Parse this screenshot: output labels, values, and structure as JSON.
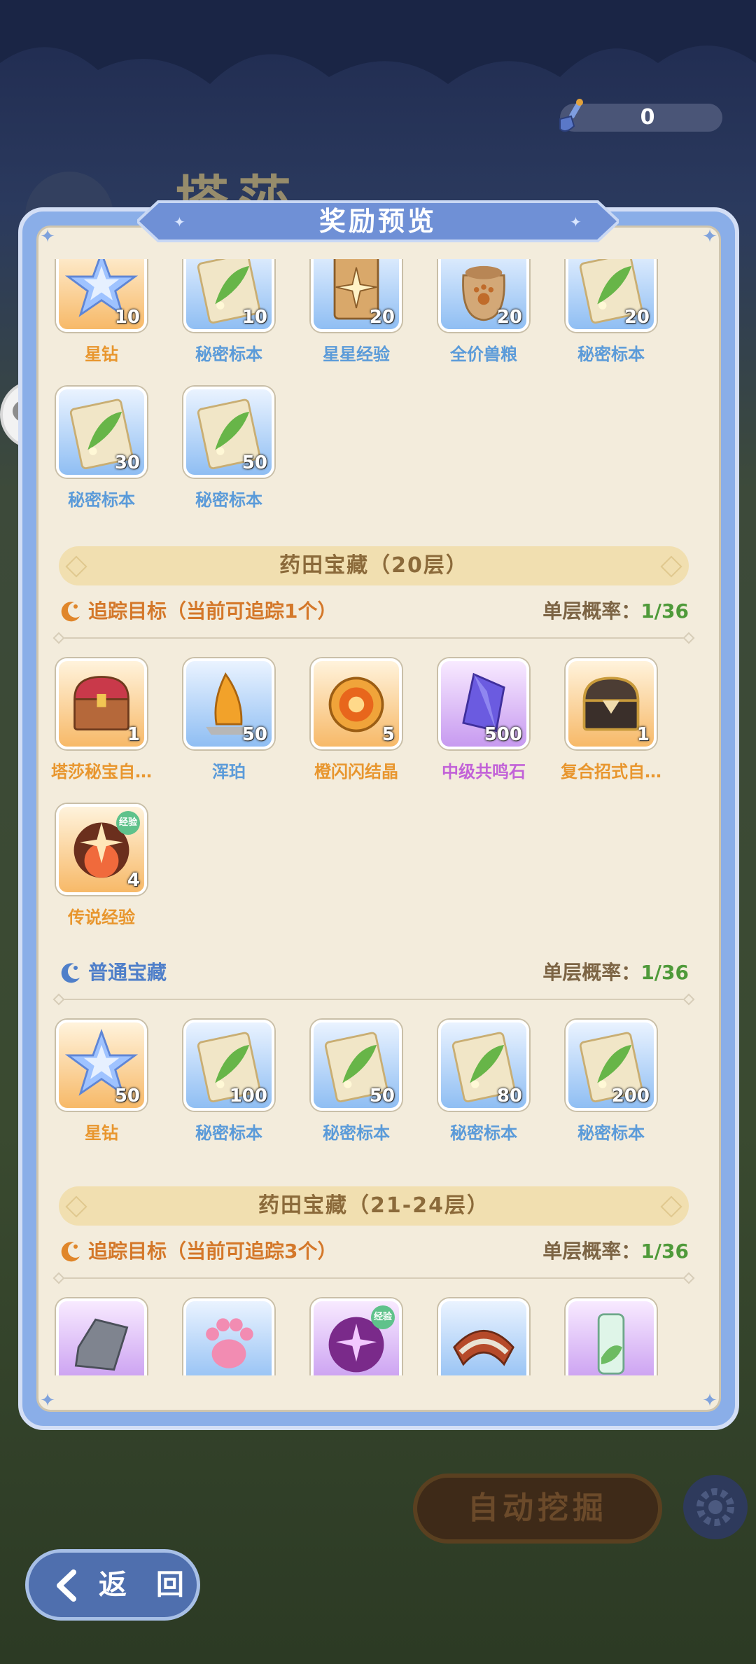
{
  "hud": {
    "shovel_count": "0",
    "background_title": "塔莎"
  },
  "dialog": {
    "title": "奖励预览"
  },
  "top_items": [
    {
      "label": "星钻",
      "count": "10",
      "kind": "star",
      "frame": "orange",
      "color": "orange"
    },
    {
      "label": "秘密标本",
      "count": "10",
      "kind": "leaf",
      "frame": "blue",
      "color": "blue"
    },
    {
      "label": "星星经验",
      "count": "20",
      "kind": "card",
      "frame": "blue",
      "color": "blue"
    },
    {
      "label": "全价兽粮",
      "count": "20",
      "kind": "bag",
      "frame": "blue",
      "color": "blue"
    },
    {
      "label": "秘密标本",
      "count": "20",
      "kind": "leaf",
      "frame": "blue",
      "color": "blue"
    },
    {
      "label": "秘密标本",
      "count": "30",
      "kind": "leaf",
      "frame": "blue",
      "color": "blue"
    },
    {
      "label": "秘密标本",
      "count": "50",
      "kind": "leaf",
      "frame": "blue",
      "color": "blue"
    }
  ],
  "sections": [
    {
      "title": "药田宝藏（20层）",
      "groups": [
        {
          "name": "追踪目标（当前可追踪1个）",
          "name_color": "orange",
          "prob_label": "单层概率：",
          "prob_value": "1/36",
          "items": [
            {
              "label": "塔莎秘宝自…",
              "count": "1",
              "kind": "chest",
              "frame": "orange",
              "color": "orange"
            },
            {
              "label": "浑珀",
              "count": "50",
              "kind": "amber",
              "frame": "blue",
              "color": "blue"
            },
            {
              "label": "橙闪闪结晶",
              "count": "5",
              "kind": "orb",
              "frame": "orange",
              "color": "orange"
            },
            {
              "label": "中级共鸣石",
              "count": "500",
              "kind": "crystal",
              "frame": "purple",
              "color": "purple"
            },
            {
              "label": "复合招式自…",
              "count": "1",
              "kind": "chest2",
              "frame": "orange",
              "color": "orange"
            },
            {
              "label": "传说经验",
              "count": "4",
              "kind": "xp",
              "frame": "orange",
              "color": "orange",
              "badge": "经验"
            }
          ]
        },
        {
          "name": "普通宝藏",
          "name_color": "blue",
          "prob_label": "单层概率：",
          "prob_value": "1/36",
          "items": [
            {
              "label": "星钻",
              "count": "50",
              "kind": "star",
              "frame": "orange",
              "color": "orange"
            },
            {
              "label": "秘密标本",
              "count": "100",
              "kind": "leaf",
              "frame": "blue",
              "color": "blue"
            },
            {
              "label": "秘密标本",
              "count": "50",
              "kind": "leaf",
              "frame": "blue",
              "color": "blue"
            },
            {
              "label": "秘密标本",
              "count": "80",
              "kind": "leaf",
              "frame": "blue",
              "color": "blue"
            },
            {
              "label": "秘密标本",
              "count": "200",
              "kind": "leaf",
              "frame": "blue",
              "color": "blue"
            }
          ]
        }
      ]
    },
    {
      "title": "药田宝藏（21-24层）",
      "groups": [
        {
          "name": "追踪目标（当前可追踪3个）",
          "name_color": "orange",
          "prob_label": "单层概率：",
          "prob_value": "1/36",
          "items": [
            {
              "label": "",
              "count": "",
              "kind": "ingot",
              "frame": "purple",
              "color": "purple"
            },
            {
              "label": "",
              "count": "",
              "kind": "paw",
              "frame": "blue",
              "color": "blue"
            },
            {
              "label": "",
              "count": "",
              "kind": "xp2",
              "frame": "purple",
              "color": "purple",
              "badge": "经验"
            },
            {
              "label": "",
              "count": "",
              "kind": "scarf",
              "frame": "blue",
              "color": "blue"
            },
            {
              "label": "",
              "count": "",
              "kind": "bottle",
              "frame": "purple",
              "color": "purple"
            }
          ]
        }
      ]
    }
  ],
  "buttons": {
    "auto_dig": "自动挖掘",
    "back": "返 回"
  }
}
